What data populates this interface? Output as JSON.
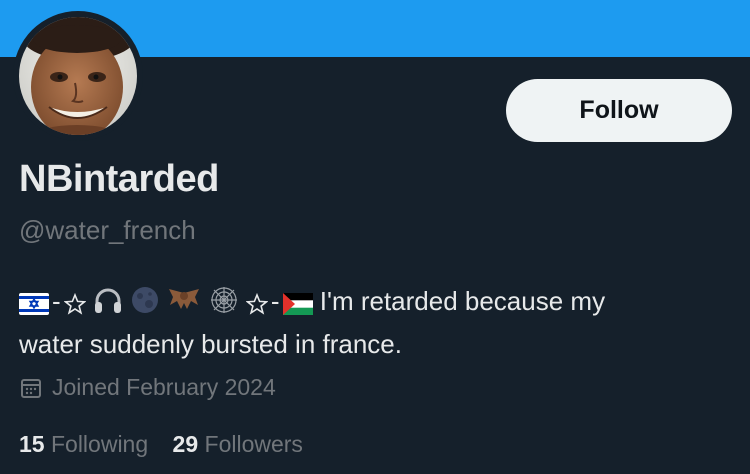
{
  "profile": {
    "display_name": "NBintarded",
    "handle": "@water_french",
    "bio_text_line1": "I'm retarded because my",
    "bio_text_line2": "water suddenly bursted in france.",
    "bio_emojis": [
      "israel-flag",
      "star",
      "headphones",
      "moon",
      "bat",
      "spider-web",
      "star",
      "palestine-flag"
    ],
    "joined": "Joined February 2024",
    "following_count": "15",
    "following_label": "Following",
    "followers_count": "29",
    "followers_label": "Followers"
  },
  "actions": {
    "follow_label": "Follow"
  },
  "colors": {
    "banner": "#1d9bf0",
    "background": "#15202b",
    "primary_text": "#e7e9ea",
    "secondary_text": "#71767b",
    "button_bg": "#eff3f4"
  }
}
